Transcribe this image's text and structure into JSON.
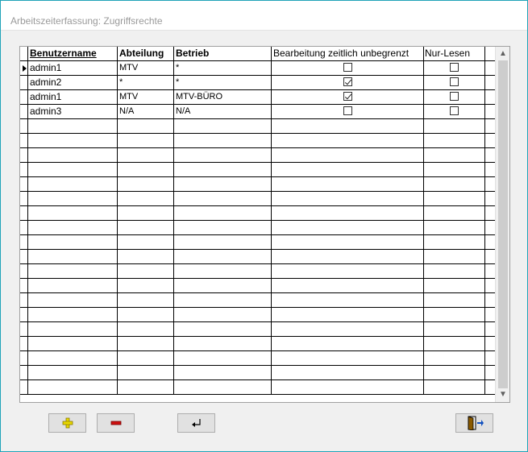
{
  "window": {
    "title": "Arbeitszeiterfassung: Zugriffsrechte"
  },
  "grid": {
    "columns": [
      "Benutzername",
      "Abteilung",
      "Betrieb",
      "Bearbeitung zeitlich unbegrenzt",
      "Nur-Lesen"
    ],
    "rows": [
      {
        "benutzername": "admin1",
        "abteilung": "MTV",
        "betrieb": "*",
        "unbegrenzt": false,
        "nur_lesen": false,
        "current": true
      },
      {
        "benutzername": "admin2",
        "abteilung": "*",
        "betrieb": "*",
        "unbegrenzt": true,
        "nur_lesen": false,
        "current": false
      },
      {
        "benutzername": "admin1",
        "abteilung": "MTV",
        "betrieb": "MTV-BÜRO",
        "unbegrenzt": true,
        "nur_lesen": false,
        "current": false
      },
      {
        "benutzername": "admin3",
        "abteilung": "N/A",
        "betrieb": "N/A",
        "unbegrenzt": false,
        "nur_lesen": false,
        "current": false
      }
    ],
    "empty_rows": 19
  },
  "toolbar": {
    "add_icon": "plus-icon",
    "delete_icon": "minus-icon",
    "save_icon": "enter-return-icon",
    "exit_icon": "exit-door-icon"
  },
  "colors": {
    "window_border": "#1fa3b8",
    "plus": "#e8d800",
    "minus": "#d01010"
  }
}
